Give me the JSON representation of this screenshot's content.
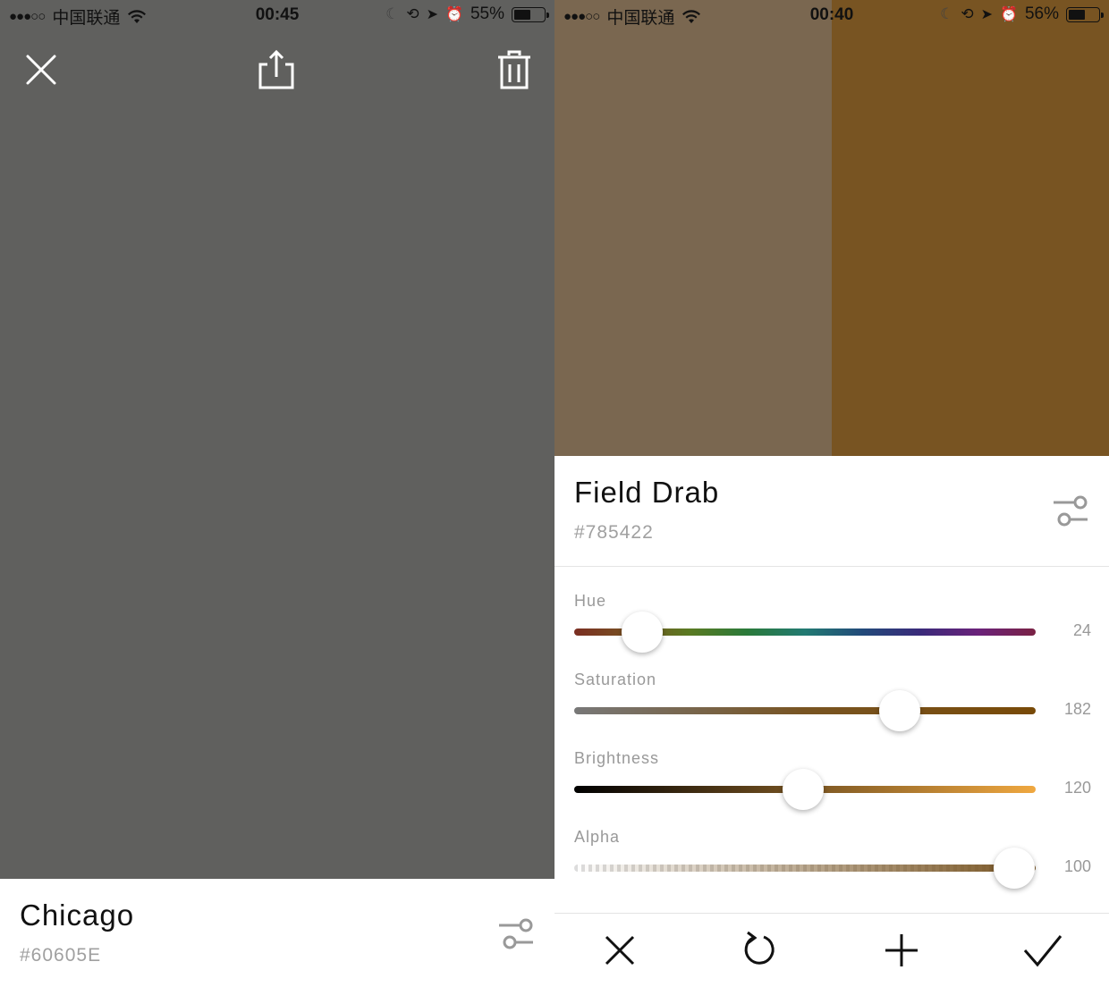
{
  "left": {
    "status": {
      "carrier": "中国联通",
      "time": "00:45",
      "battery": "55%",
      "battery_level": 0.55
    },
    "background_color": "#60605E",
    "color_name": "Chicago",
    "color_hex": "#60605E",
    "icons": [
      "close-icon",
      "share-icon",
      "trash-icon",
      "adjust-icon"
    ]
  },
  "right": {
    "status": {
      "carrier": "中国联通",
      "time": "00:40",
      "battery": "56%",
      "battery_level": 0.56
    },
    "swatch_old_color": "#7A6750",
    "swatch_new_color": "#785422",
    "color_name": "Field Drab",
    "color_hex": "#785422",
    "sliders": [
      {
        "label": "Hue",
        "value": "24",
        "max": 360
      },
      {
        "label": "Saturation",
        "value": "182",
        "max": 255
      },
      {
        "label": "Brightness",
        "value": "120",
        "max": 255
      },
      {
        "label": "Alpha",
        "value": "100",
        "max": 100
      }
    ],
    "toolbar": [
      "cancel-icon",
      "undo-icon",
      "add-icon",
      "confirm-icon"
    ]
  }
}
